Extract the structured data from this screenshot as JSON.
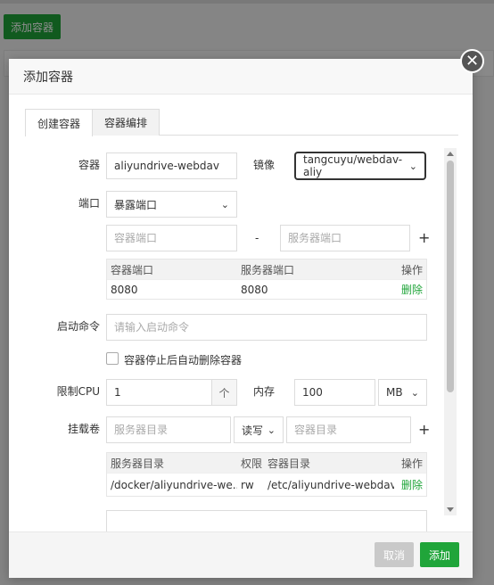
{
  "background": {
    "add_button_label": "添加容器"
  },
  "modal": {
    "title": "添加容器",
    "close_glyph": "✕"
  },
  "tabs": [
    {
      "label": "创建容器",
      "active": true
    },
    {
      "label": "容器编排",
      "active": false
    }
  ],
  "form": {
    "container_label": "容器",
    "container_value": "aliyundrive-webdav",
    "image_label": "镜像",
    "image_value": "tangcuyu/webdav-aliy",
    "port_label": "端口",
    "port_mode_value": "暴露端口",
    "container_port_placeholder": "容器端口",
    "port_separator": "-",
    "server_port_placeholder": "服务器端口",
    "add_glyph": "+",
    "port_table": {
      "headers": [
        "容器端口",
        "服务器端口",
        "操作"
      ],
      "rows": [
        {
          "container_port": "8080",
          "server_port": "8080",
          "action": "删除"
        }
      ]
    },
    "command_label": "启动命令",
    "command_placeholder": "请输入启动命令",
    "auto_remove_label": "容器停止后自动删除容器",
    "auto_remove_checked": false,
    "cpu_label": "限制CPU",
    "cpu_value": "1",
    "cpu_stepper_glyph": "个",
    "memory_label": "内存",
    "memory_value": "100",
    "memory_unit": "MB",
    "volume_label": "挂载卷",
    "server_dir_placeholder": "服务器目录",
    "permission_value": "读写",
    "container_dir_placeholder": "容器目录",
    "volume_table": {
      "headers": [
        "服务器目录",
        "权限",
        "容器目录",
        "操作"
      ],
      "rows": [
        {
          "server_dir": "/docker/aliyundrive-we...",
          "permission": "rw",
          "container_dir": "/etc/aliyundrive-webdav/",
          "action": "删除"
        }
      ]
    }
  },
  "footer": {
    "cancel_label": "取消",
    "add_label": "添加"
  },
  "colors": {
    "primary_green": "#20a53a",
    "disabled_gray": "#c9c9c9"
  }
}
